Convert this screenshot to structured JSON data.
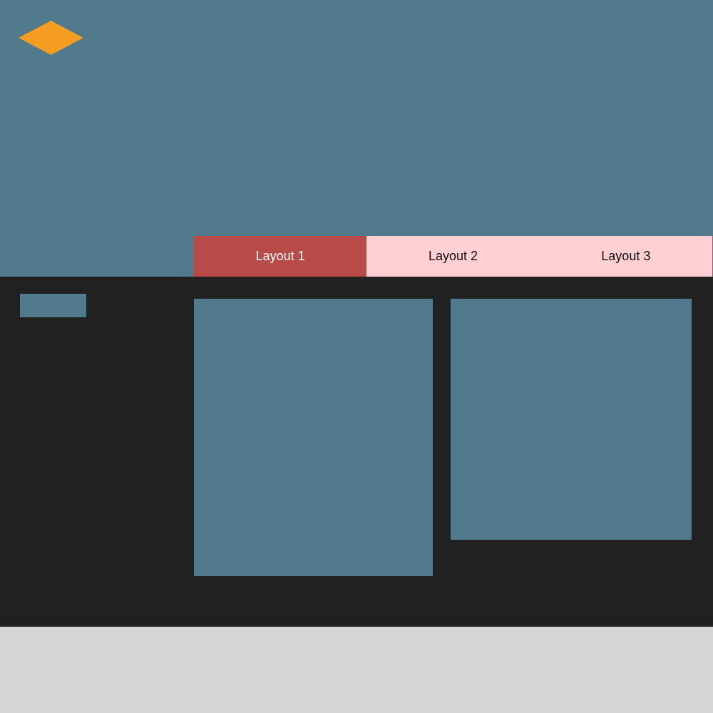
{
  "theme": {
    "header_bg": "#517a8c",
    "main_bg": "#212121",
    "footer_bg": "#d6d6d6",
    "accent_logo": "#f49d22",
    "tab_active_bg": "#b84b48",
    "tab_inactive_bg": "#ffcfd2"
  },
  "header": {
    "logo_icon": "diamond-logo-icon"
  },
  "tabs": [
    {
      "label": "Layout 1",
      "active": true
    },
    {
      "label": "Layout 2",
      "active": false
    },
    {
      "label": "Layout 3",
      "active": false
    }
  ]
}
